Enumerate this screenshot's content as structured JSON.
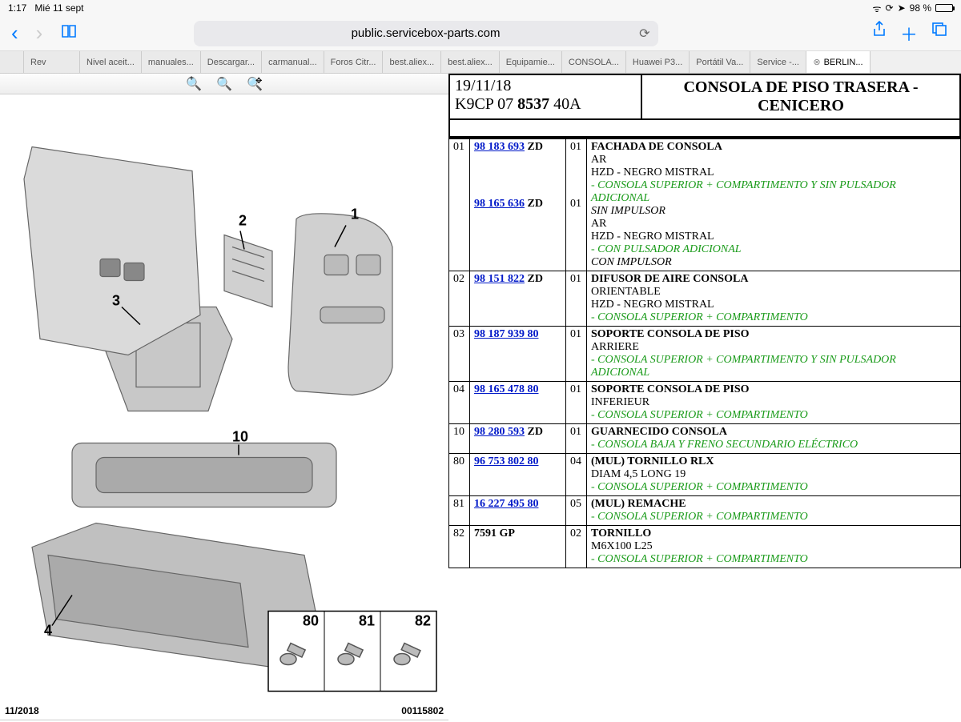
{
  "status": {
    "time": "1:17",
    "date": "Mié 11 sept",
    "battery": "98 %"
  },
  "nav": {
    "url": "public.servicebox-parts.com"
  },
  "tabs": [
    {
      "label": ""
    },
    {
      "label": "Rev"
    },
    {
      "label": "Nivel aceit..."
    },
    {
      "label": "manuales..."
    },
    {
      "label": "Descargar..."
    },
    {
      "label": "carmanual..."
    },
    {
      "label": "Foros Citr..."
    },
    {
      "label": "best.aliex..."
    },
    {
      "label": "best.aliex..."
    },
    {
      "label": "Equipamie..."
    },
    {
      "label": "CONSOLA..."
    },
    {
      "label": "Huawei P3..."
    },
    {
      "label": "Portátil Va..."
    },
    {
      "label": "Service -..."
    },
    {
      "label": "BERLIN...",
      "active": true,
      "close": true
    }
  ],
  "diagram": {
    "callouts": [
      "1",
      "2",
      "3",
      "4",
      "10",
      "80",
      "81",
      "82"
    ],
    "bottom_left": "11/2018",
    "bottom_right": "00115802"
  },
  "doc": {
    "date": "19/11/18",
    "code_prefix": "K9CP 07 ",
    "code_bold": "8537",
    "code_suffix": " 40A",
    "title": "CONSOLA DE PISO TRASERA - CENICERO"
  },
  "parts": [
    {
      "id": "01",
      "refs": [
        {
          "num": "98 183 693",
          "suf": " ZD",
          "qty": "01"
        },
        {
          "num": "98 165 636",
          "suf": " ZD",
          "qty": "01"
        }
      ],
      "desc": [
        {
          "t": "title",
          "v": "FACHADA DE CONSOLA"
        },
        {
          "t": "plain",
          "v": "AR"
        },
        {
          "t": "plain",
          "v": "HZD - NEGRO MISTRAL"
        },
        {
          "t": "note",
          "v": "- CONSOLA SUPERIOR + COMPARTIMENTO Y SIN PULSADOR ADICIONAL"
        },
        {
          "t": "plain-it",
          "v": "SIN IMPULSOR"
        },
        {
          "t": "plain",
          "v": "AR"
        },
        {
          "t": "plain",
          "v": "HZD - NEGRO MISTRAL"
        },
        {
          "t": "note",
          "v": "- CON PULSADOR ADICIONAL"
        },
        {
          "t": "plain-it",
          "v": "CON IMPULSOR"
        }
      ]
    },
    {
      "id": "02",
      "refs": [
        {
          "num": "98 151 822",
          "suf": " ZD",
          "qty": "01"
        }
      ],
      "desc": [
        {
          "t": "title",
          "v": "DIFUSOR DE AIRE CONSOLA"
        },
        {
          "t": "plain",
          "v": "ORIENTABLE"
        },
        {
          "t": "plain",
          "v": "HZD - NEGRO MISTRAL"
        },
        {
          "t": "note",
          "v": "- CONSOLA SUPERIOR + COMPARTIMENTO"
        }
      ]
    },
    {
      "id": "03",
      "refs": [
        {
          "num": "98 187 939 80",
          "suf": "",
          "qty": "01"
        }
      ],
      "desc": [
        {
          "t": "title",
          "v": "SOPORTE CONSOLA DE PISO"
        },
        {
          "t": "plain",
          "v": "ARRIERE"
        },
        {
          "t": "note",
          "v": "- CONSOLA SUPERIOR + COMPARTIMENTO Y SIN PULSADOR ADICIONAL"
        }
      ]
    },
    {
      "id": "04",
      "refs": [
        {
          "num": "98 165 478 80",
          "suf": "",
          "qty": "01"
        }
      ],
      "desc": [
        {
          "t": "title",
          "v": "SOPORTE CONSOLA DE PISO"
        },
        {
          "t": "plain",
          "v": "INFERIEUR"
        },
        {
          "t": "note",
          "v": "- CONSOLA SUPERIOR + COMPARTIMENTO"
        }
      ]
    },
    {
      "id": "10",
      "refs": [
        {
          "num": "98 280 593",
          "suf": " ZD",
          "qty": "01"
        }
      ],
      "desc": [
        {
          "t": "title",
          "v": "GUARNECIDO CONSOLA"
        },
        {
          "t": "note",
          "v": "- CONSOLA BAJA Y FRENO SECUNDARIO ELÉCTRICO"
        }
      ]
    },
    {
      "id": "80",
      "refs": [
        {
          "num": "96 753 802 80",
          "suf": "",
          "qty": "04"
        }
      ],
      "desc": [
        {
          "t": "title",
          "v": "(MUL) TORNILLO RLX"
        },
        {
          "t": "plain",
          "v": "DIAM 4,5 LONG 19"
        },
        {
          "t": "note",
          "v": "- CONSOLA SUPERIOR + COMPARTIMENTO"
        }
      ]
    },
    {
      "id": "81",
      "refs": [
        {
          "num": "16 227 495 80",
          "suf": "",
          "qty": "05"
        }
      ],
      "desc": [
        {
          "t": "title",
          "v": "(MUL) REMACHE"
        },
        {
          "t": "note",
          "v": "- CONSOLA SUPERIOR + COMPARTIMENTO"
        }
      ]
    },
    {
      "id": "82",
      "refs": [
        {
          "num": "7591 GP",
          "suf": "",
          "qty": "02",
          "nolink": true
        }
      ],
      "desc": [
        {
          "t": "title",
          "v": "TORNILLO"
        },
        {
          "t": "plain",
          "v": "M6X100 L25"
        },
        {
          "t": "note",
          "v": "- CONSOLA SUPERIOR + COMPARTIMENTO"
        }
      ]
    }
  ]
}
